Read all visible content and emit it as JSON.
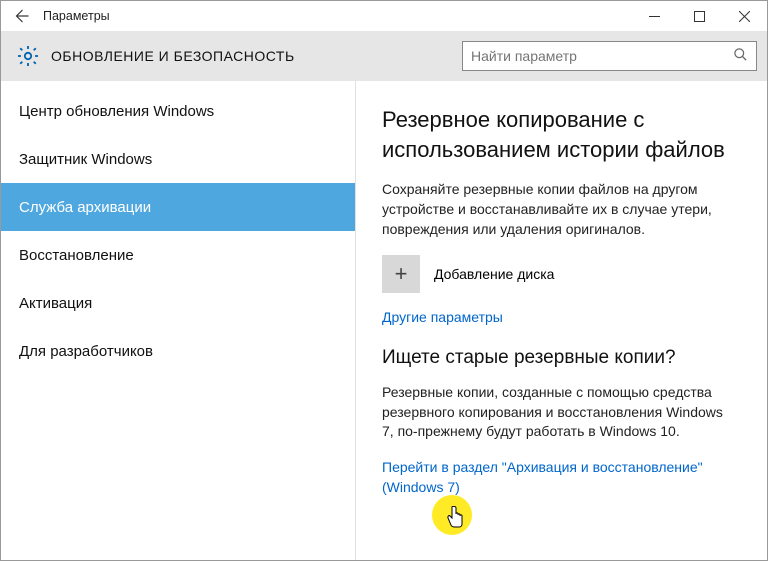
{
  "titlebar": {
    "title": "Параметры"
  },
  "header": {
    "caption": "ОБНОВЛЕНИЕ И БЕЗОПАСНОСТЬ",
    "search_placeholder": "Найти параметр"
  },
  "sidebar": {
    "items": [
      {
        "label": "Центр обновления Windows",
        "active": false
      },
      {
        "label": "Защитник Windows",
        "active": false
      },
      {
        "label": "Служба архивации",
        "active": true
      },
      {
        "label": "Восстановление",
        "active": false
      },
      {
        "label": "Активация",
        "active": false
      },
      {
        "label": "Для разработчиков",
        "active": false
      }
    ]
  },
  "content": {
    "heading": "Резервное копирование с использованием истории файлов",
    "paragraph1": "Сохраняйте резервные копии файлов на другом устройстве и восстанавливайте их в случае утери, повреждения или удаления оригиналов.",
    "add_disk_label": "Добавление диска",
    "more_options_link": "Другие параметры",
    "subheading": "Ищете старые резервные копии?",
    "paragraph2": "Резервные копии, созданные с помощью средства резервного копирования и восстановления Windows 7, по-прежнему будут работать в Windows 10.",
    "legacy_link": "Перейти в раздел \"Архивация и восстановление\" (Windows 7)"
  }
}
